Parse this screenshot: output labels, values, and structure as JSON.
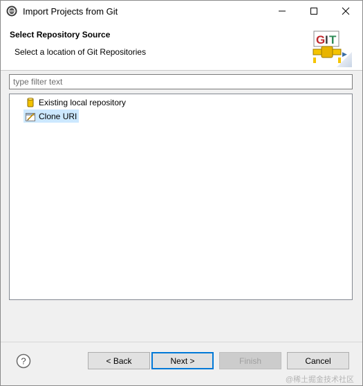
{
  "window": {
    "title": "Import Projects from Git"
  },
  "header": {
    "title": "Select Repository Source",
    "description": "Select a location of Git Repositories",
    "logo_text": "GIT"
  },
  "filter": {
    "placeholder": "type filter text",
    "value": ""
  },
  "tree": {
    "items": [
      {
        "label": "Existing local repository",
        "icon": "repository-cylinder-icon",
        "selected": false
      },
      {
        "label": "Clone URI",
        "icon": "clone-uri-icon",
        "selected": true
      }
    ]
  },
  "buttons": {
    "back": "< Back",
    "next": "Next >",
    "finish": "Finish",
    "cancel": "Cancel"
  },
  "watermark": "@稀土掘金技术社区",
  "colors": {
    "selection": "#cce8ff",
    "default_button_border": "#0078d7",
    "repository_icon": "#f2c200"
  }
}
